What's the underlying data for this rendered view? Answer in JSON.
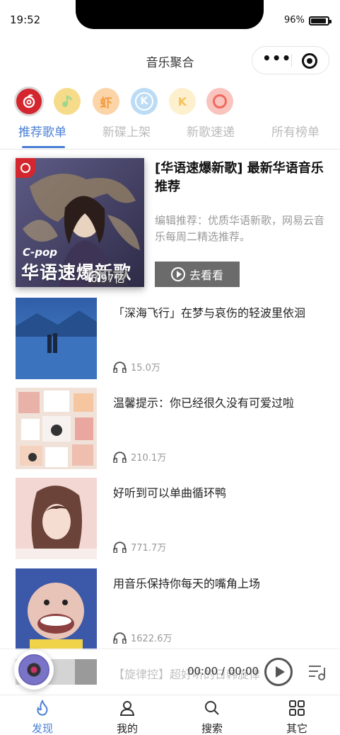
{
  "status": {
    "time": "19:52",
    "battery": "96%"
  },
  "nav": {
    "title": "音乐聚合",
    "more_icon": "more-dots-icon",
    "close_icon": "target-circle-icon"
  },
  "platforms": [
    {
      "name": "netease",
      "icon": "netease-cloud-icon",
      "color": "#d3262e",
      "active": true
    },
    {
      "name": "qq-music",
      "icon": "qq-music-icon",
      "color": "#f2c94c",
      "active": false
    },
    {
      "name": "xiami",
      "icon": "xiami-icon",
      "color": "#f7a44a",
      "active": false
    },
    {
      "name": "kugou",
      "icon": "kugou-icon",
      "color": "#5aa6e8",
      "active": false
    },
    {
      "name": "kuwo",
      "icon": "kuwo-icon",
      "color": "#f5c25b",
      "active": false
    },
    {
      "name": "qianqian",
      "icon": "qianqian-icon",
      "color": "#ee6a5e",
      "active": false
    }
  ],
  "tabs": [
    "推荐歌单",
    "新碟上架",
    "新歌速递",
    "所有榜单"
  ],
  "featured": {
    "cover_tag": "C-pop",
    "cover_text": "华语速爆新歌",
    "play_count": "6.97亿",
    "title": "[华语速爆新歌] 最新华语音乐推荐",
    "desc": "编辑推荐：优质华语新歌，网易云音乐每周二精选推荐。",
    "button": "去看看"
  },
  "playlists": [
    {
      "title": "「深海飞行」在梦与哀伤的轻波里依洄",
      "count": "15.0万"
    },
    {
      "title": "温馨提示：你已经很久没有可爱过啦",
      "count": "210.1万"
    },
    {
      "title": "好听到可以单曲循环鸭",
      "count": "771.7万"
    },
    {
      "title": "用音乐保持你每天的嘴角上场",
      "count": "1622.6万"
    }
  ],
  "player": {
    "title": "【旋律控】超",
    "title_tail": "好听的日韩旋律",
    "time": "00:00 / 00:00"
  },
  "tabbar": [
    {
      "label": "发现",
      "icon": "flame-icon",
      "active": true
    },
    {
      "label": "我的",
      "icon": "user-icon",
      "active": false
    },
    {
      "label": "搜索",
      "icon": "search-icon",
      "active": false
    },
    {
      "label": "其它",
      "icon": "grid-icon",
      "active": false
    }
  ]
}
